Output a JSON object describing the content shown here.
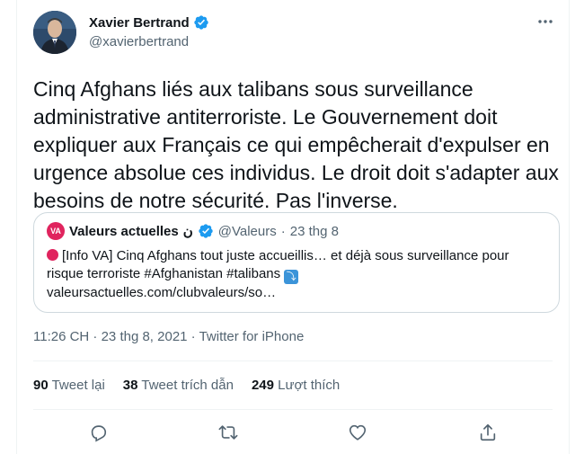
{
  "author": {
    "name": "Xavier Bertrand",
    "handle": "@xavierbertrand",
    "verified_icon": "verified-badge-icon"
  },
  "tweet": {
    "text": "Cinq Afghans liés aux talibans sous surveillance administrative antiterroriste. Le Gouvernement doit expliquer aux Français ce qui empêcherait d'expulser en urgence absolue ces individus. Le droit doit s'adapter aux besoins de notre sécurité. Pas l'inverse."
  },
  "quote": {
    "logo_text": "VA",
    "name": "Valeurs actuelles",
    "name_suffix": "ن",
    "handle": "@Valeurs",
    "separator": "·",
    "date": "23 thg 8",
    "text": "[Info VA] Cinq Afghans tout juste accueillis… et déjà sous surveillance pour risque terroriste #Afghanistan #talibans",
    "link": "valeursactuelles.com/clubvaleurs/so…"
  },
  "timestamp": "11:26 CH · 23 thg 8, 2021 · Twitter for iPhone",
  "stats": {
    "retweets_count": "90",
    "retweets_label": "Tweet lại",
    "quotes_count": "38",
    "quotes_label": "Tweet trích dẫn",
    "likes_count": "249",
    "likes_label": "Lượt thích"
  },
  "colors": {
    "verified": "#1d9bf0",
    "accent_red": "#e0245e",
    "muted_text": "#536471"
  }
}
